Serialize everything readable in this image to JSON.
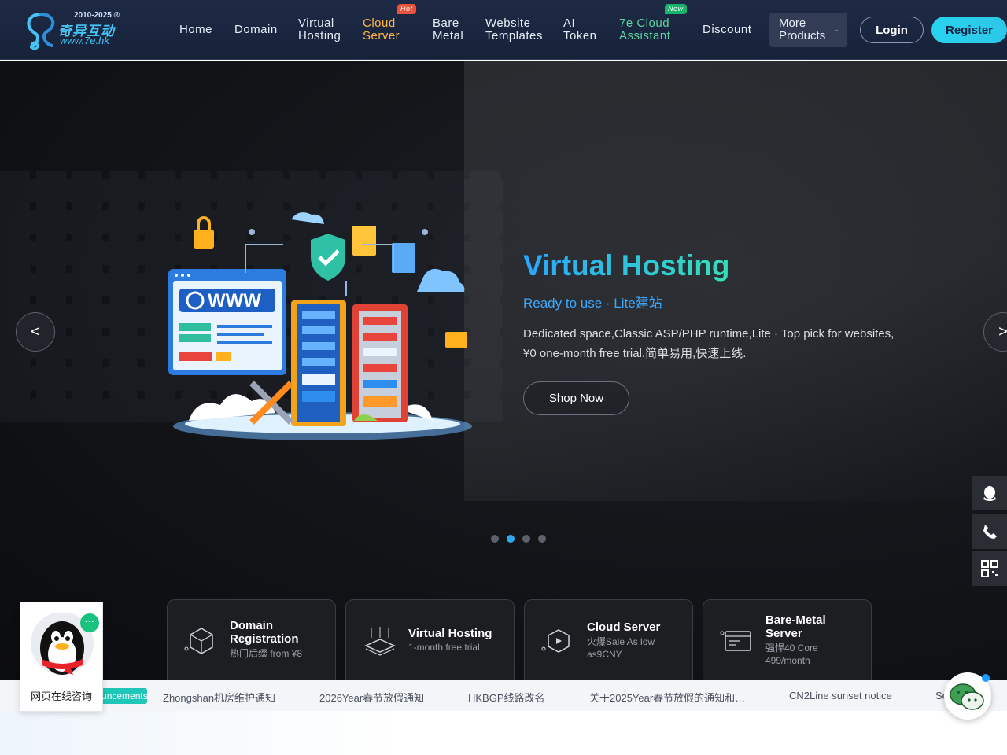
{
  "brand": {
    "years": "2010-2025 ®",
    "name_cn": "奇异互动",
    "url": "www.7e.hk"
  },
  "nav": {
    "home": "Home",
    "domain": "Domain",
    "virtual_hosting_l1": "Virtual",
    "virtual_hosting_l2": "Hosting",
    "cloud_server_l1": "Cloud",
    "cloud_server_l2": "Server",
    "cloud_server_badge": "Hot",
    "bare_metal_l1": "Bare",
    "bare_metal_l2": "Metal",
    "website_templates_l1": "Website",
    "website_templates_l2": "Templates",
    "ai_token_l1": "AI",
    "ai_token_l2": "Token",
    "assistant_l1": "7e Cloud",
    "assistant_l2": "Assistant",
    "assistant_badge": "New",
    "discount": "Discount",
    "more_l1": "More",
    "more_l2": "Products",
    "more_chevron": "⌄",
    "login": "Login",
    "register": "Register"
  },
  "hero": {
    "title": "Virtual Hosting",
    "subtitle": "Ready to use · Lite建站",
    "description": "Dedicated space,Classic ASP/PHP runtime,Lite · Top pick for websites, ¥0 one-month free trial.简单易用,快速上线.",
    "cta": "Shop Now",
    "prev": "<",
    "next": ">",
    "slide_count": 4,
    "active_slide": 2,
    "illustration_text": "WWW"
  },
  "cards": [
    {
      "title_l1": "Domain",
      "title_l2": "Registration",
      "sub_l1": "热门后缀 from ¥8",
      "sub_l2": "",
      "icon": "domain-cube-icon"
    },
    {
      "title_l1": "Virtual Hosting",
      "title_l2": "",
      "sub_l1": "1-month free trial",
      "sub_l2": "",
      "icon": "hosting-layers-icon"
    },
    {
      "title_l1": "Cloud Server",
      "title_l2": "",
      "sub_l1": "火爆Sale As low",
      "sub_l2": "as9CNY",
      "icon": "cloud-hexagon-icon"
    },
    {
      "title_l1": "Bare-Metal",
      "title_l2": "Server",
      "sub_l1": "强悍40 Core",
      "sub_l2": "499/month",
      "icon": "server-window-icon"
    }
  ],
  "announcements": {
    "label": "Announcements",
    "items": [
      "Zhongshan机房维护通知",
      "2026Year春节放假通知",
      "HKBGP线路改名",
      "关于2025Year春节放假的通知和…",
      "CN2Line sunset notice",
      "Se"
    ]
  },
  "qq_widget": {
    "label": "网页在线咨询",
    "bubble": "···"
  },
  "colors": {
    "nav_bg": "#1e2a45",
    "accent_cyan": "#28d3f0",
    "hot": "#ffb547",
    "new": "#5dd39e",
    "hero_title_gradient_start": "#2aa6ff",
    "hero_title_gradient_end": "#33e0b8",
    "announcement_label": "#1ec7b7"
  }
}
